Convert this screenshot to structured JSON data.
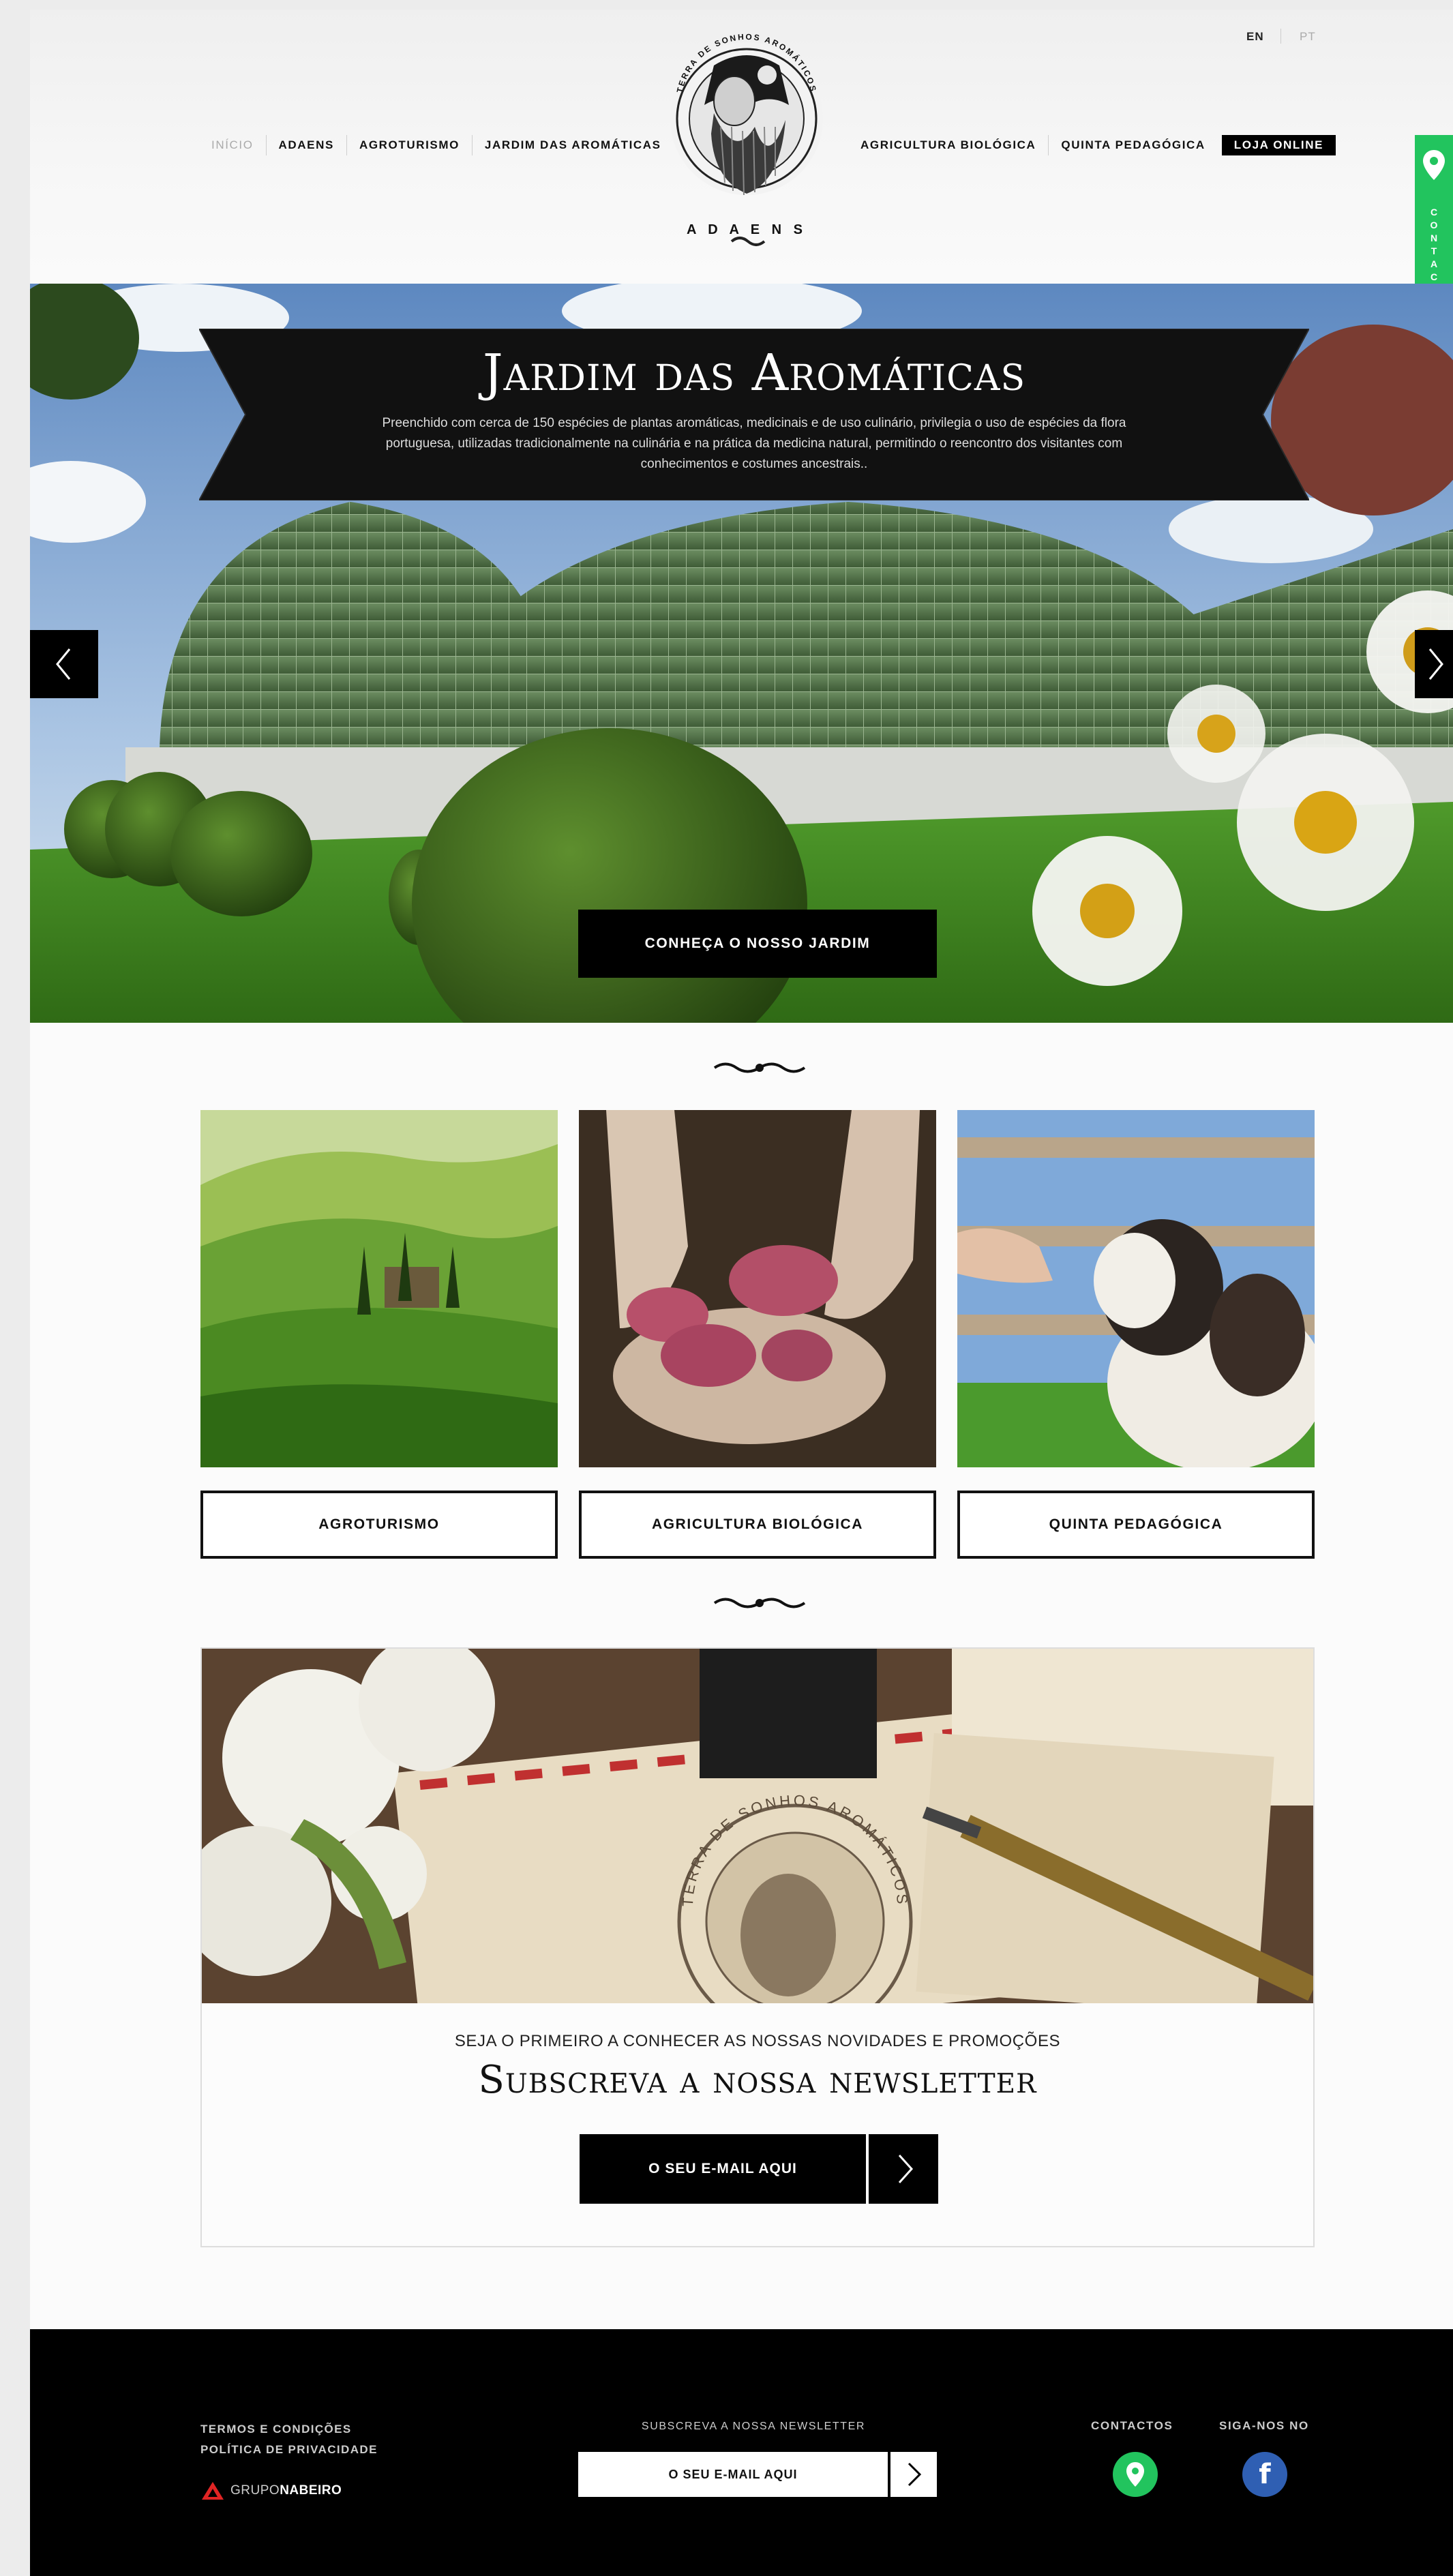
{
  "header": {
    "lang_en": "EN",
    "lang_pt": "PT",
    "nav_left": [
      "INÍCIO",
      "ADAENS",
      "AGROTURISMO",
      "JARDIM DAS AROMÁTICAS"
    ],
    "nav_right": [
      "AGRICULTURA BIOLÓGICA",
      "QUINTA PEDAGÓGICA"
    ],
    "shop_label": "LOJA ONLINE",
    "logo_arc_text": "TERRA DE SONHOS AROMÁTICOS",
    "logo_word": "A D A E N S"
  },
  "contact_tab": {
    "label": "CONTACTE-NOS"
  },
  "hero": {
    "title": "Jardim das Aromáticas",
    "description": "Preenchido com cerca de 150 espécies de plantas aromáticas, medicinais e de uso culinário, privilegia o uso de espécies da flora portuguesa, utilizadas tradicionalmente na culinária e na prática da medicina natural, permitindo o reencontro dos visitantes com conhecimentos e costumes ancestrais..",
    "button": "CONHEÇA O NOSSO JARDIM"
  },
  "cards": [
    {
      "label": "AGROTURISMO"
    },
    {
      "label": "AGRICULTURA BIOLÓGICA"
    },
    {
      "label": "QUINTA PEDAGÓGICA"
    }
  ],
  "newsletter": {
    "stamp_text": "TERRA DE SONHOS AROMÁTICOS",
    "pre": "SEJA O PRIMEIRO A CONHECER AS NOSSAS NOVIDADES E PROMOÇÕES",
    "title": "Subscreva a nossa newsletter",
    "email_placeholder": "O SEU E-MAIL AQUI"
  },
  "footer": {
    "terms": "TERMOS E CONDIÇÕES",
    "privacy": "POLÍTICA DE PRIVACIDADE",
    "brand_a": "GRUPO",
    "brand_b": "NABEIRO",
    "newsletter_label": "SUBSCREVA A NOSSA NEWSLETTER",
    "email_placeholder": "O SEU E-MAIL AQUI",
    "contacts_label": "CONTACTOS",
    "follow_label": "SIGA-NOS NO",
    "facebook_glyph": "f"
  },
  "colors": {
    "accent_green": "#22c45e",
    "facebook_blue": "#2f5fb3",
    "black": "#000000"
  }
}
